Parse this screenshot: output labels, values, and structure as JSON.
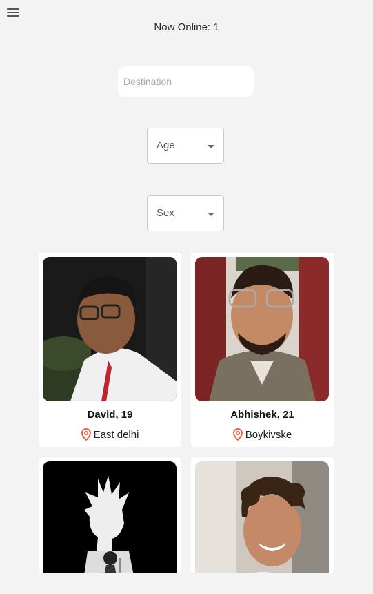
{
  "header": {
    "menu_icon": "hamburger-menu-icon",
    "online_text": "Now Online: 1"
  },
  "filters": {
    "destination_placeholder": "Destination",
    "age_label": "Age",
    "sex_label": "Sex"
  },
  "profiles": [
    {
      "name_age": "David, 19",
      "location": "East delhi",
      "location_icon": "map-pin-icon"
    },
    {
      "name_age": "Abhishek, 21",
      "location": "Boykivske",
      "location_icon": "map-pin-icon"
    },
    {
      "name_age": "",
      "location": ""
    },
    {
      "name_age": "",
      "location": ""
    }
  ],
  "colors": {
    "background": "#f3f3f3",
    "card": "#ffffff",
    "pin": "#e8553e"
  }
}
